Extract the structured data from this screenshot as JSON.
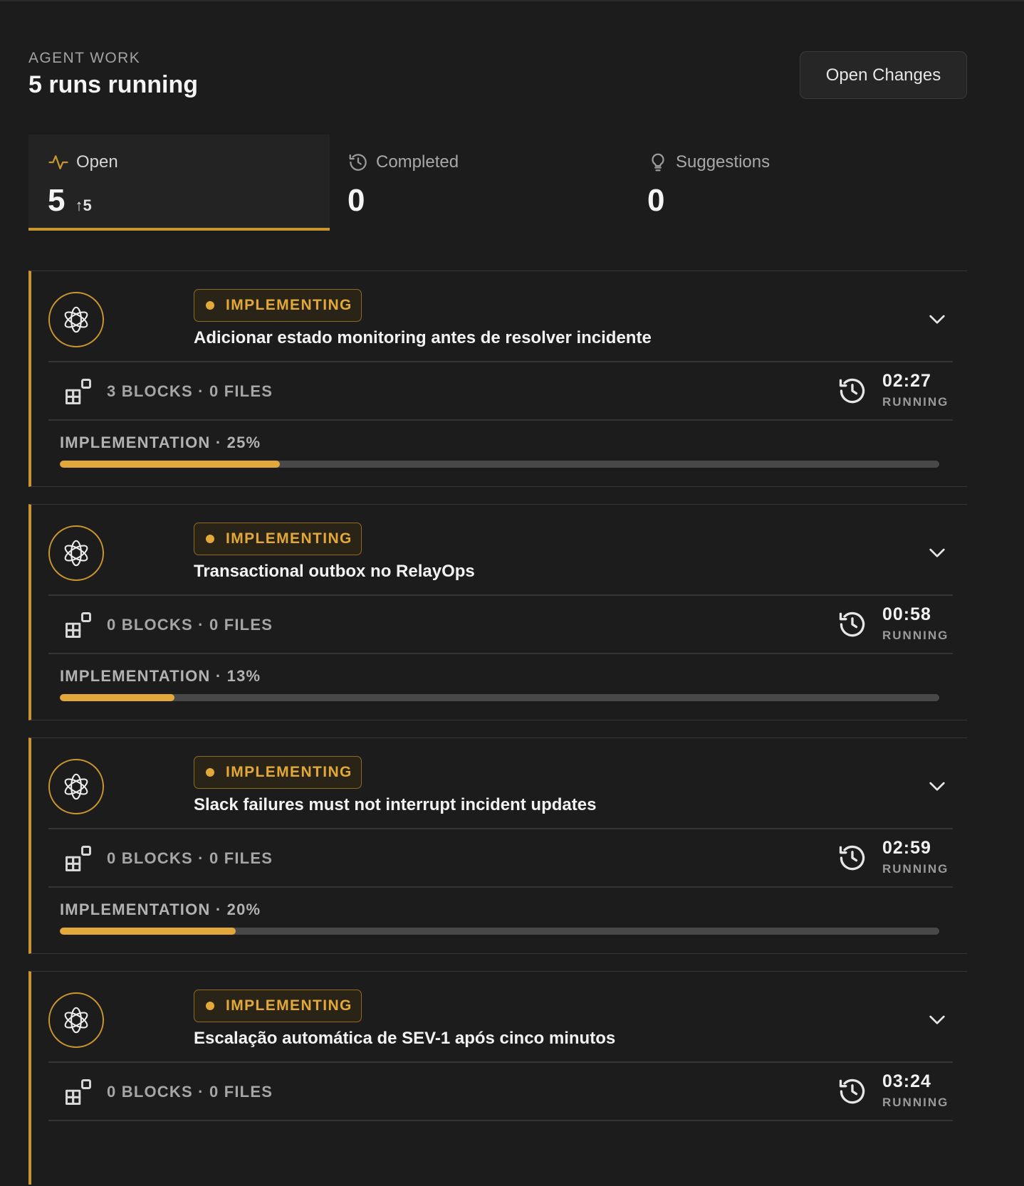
{
  "header": {
    "eyebrow": "AGENT WORK",
    "title": "5 runs running",
    "open_changes_label": "Open Changes"
  },
  "tabs": [
    {
      "label": "Open",
      "count": "5",
      "delta": "↑5",
      "icon": "activity-icon",
      "active": true
    },
    {
      "label": "Completed",
      "count": "0",
      "icon": "history-icon",
      "active": false
    },
    {
      "label": "Suggestions",
      "count": "0",
      "icon": "lightbulb-icon",
      "active": false
    }
  ],
  "runs": [
    {
      "status": "IMPLEMENTING",
      "title": "Adicionar estado monitoring antes de resolver incidente",
      "stats": "3 BLOCKS · 0 FILES",
      "time": "02:27",
      "time_status": "RUNNING",
      "progress_label": "IMPLEMENTATION · 25%",
      "progress": 0.25
    },
    {
      "status": "IMPLEMENTING",
      "title": "Transactional outbox no RelayOps",
      "stats": "0 BLOCKS · 0 FILES",
      "time": "00:58",
      "time_status": "RUNNING",
      "progress_label": "IMPLEMENTATION · 13%",
      "progress": 0.13
    },
    {
      "status": "IMPLEMENTING",
      "title": "Slack failures must not interrupt incident updates",
      "stats": "0 BLOCKS · 0 FILES",
      "time": "02:59",
      "time_status": "RUNNING",
      "progress_label": "IMPLEMENTATION · 20%",
      "progress": 0.2
    },
    {
      "status": "IMPLEMENTING",
      "title": "Escalação automática de SEV-1 após cinco minutos",
      "stats": "0 BLOCKS · 0 FILES",
      "time": "03:24",
      "time_status": "RUNNING"
    }
  ],
  "colors": {
    "accent": "#c9952f",
    "accent_text": "#e2a83a",
    "background": "#1c1c1c"
  }
}
